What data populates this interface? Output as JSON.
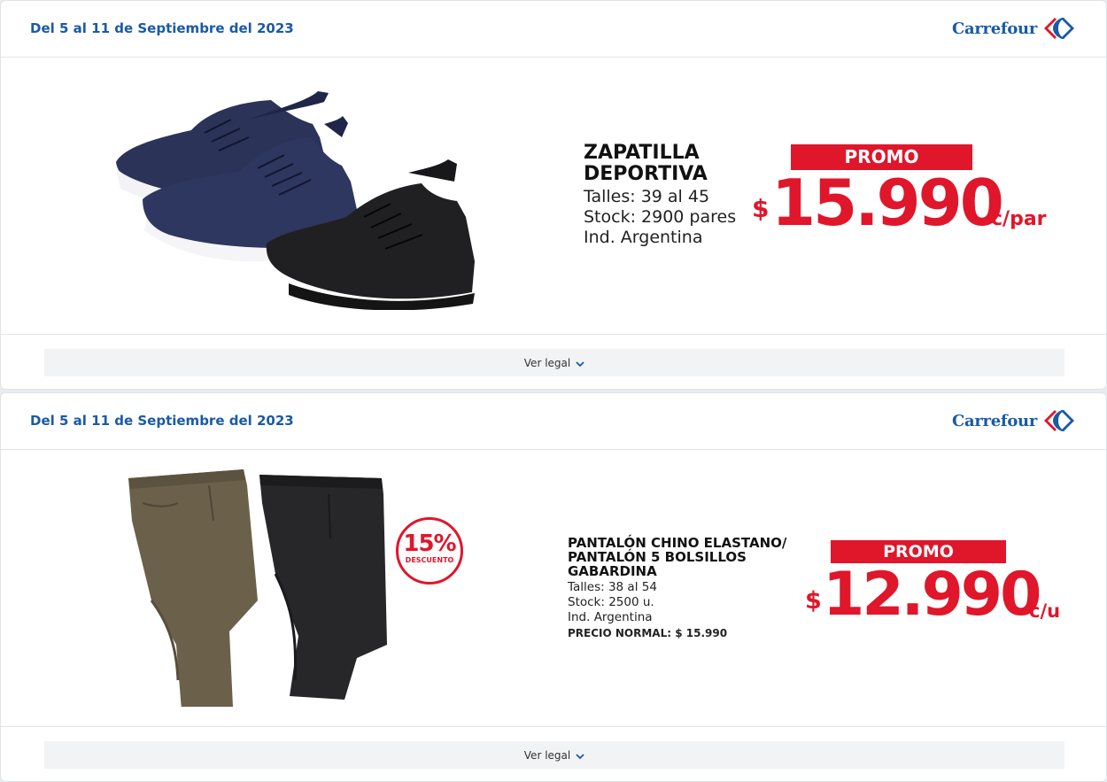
{
  "brand": {
    "name": "Carrefour",
    "color": "#1a5aa6",
    "accent": "#e0162b"
  },
  "offers": [
    {
      "date": "Del 5 al 11 de Septiembre del 2023",
      "title_lines": [
        "ZAPATILLA",
        "DEPORTIVA"
      ],
      "info": [
        "Talles: 39 al 45",
        "Stock: 2900 pares",
        "Ind. Argentina"
      ],
      "promo": "PROMO",
      "currency": "$",
      "price": "15.990",
      "unit": "c/par",
      "legal": "Ver legal"
    },
    {
      "date": "Del 5 al 11 de Septiembre del 2023",
      "title_lines": [
        "PANTALÓN CHINO ELASTANO/",
        "PANTALÓN 5 BOLSILLOS",
        "GABARDINA"
      ],
      "info": [
        "Talles: 38 al 54",
        "Stock: 2500 u.",
        "Ind. Argentina"
      ],
      "normal_price": "PRECIO NORMAL: $ 15.990",
      "discount": {
        "pct": "15%",
        "label": "DESCUENTO"
      },
      "promo": "PROMO",
      "currency": "$",
      "price": "12.990",
      "unit": "c/u",
      "legal": "Ver legal"
    }
  ]
}
